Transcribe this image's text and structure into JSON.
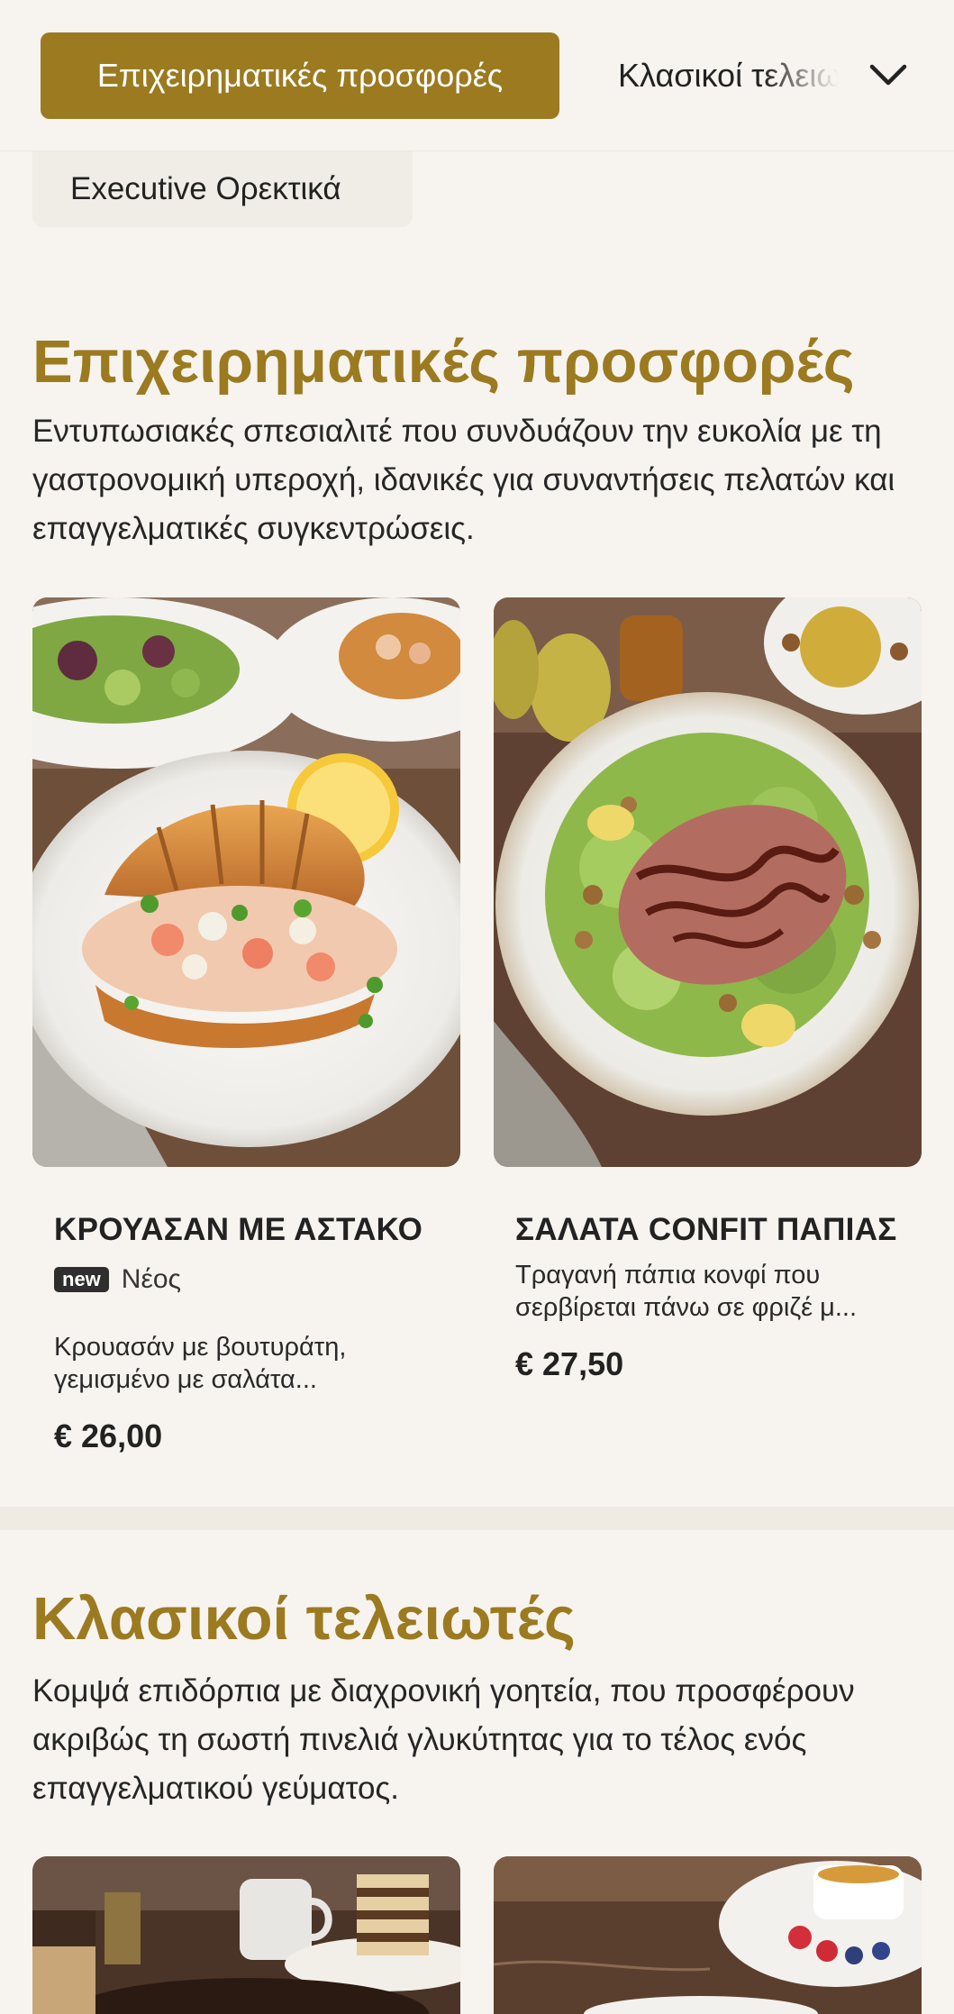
{
  "nav": {
    "active_category": "Επιχειρηματικές προσφορές",
    "next_category": "Κλασικοί τελειωτές",
    "subcategory": "Executive Ορεκτικά"
  },
  "sections": [
    {
      "title": "Επιχειρηματικές προσφορές",
      "description": "Εντυπωσιακές σπεσιαλιτέ που συνδυάζουν την ευκολία με τη γαστρονομική υπεροχή, ιδανικές για συναντήσεις πελατών και επαγγελματικές συγκεντρώσεις.",
      "items": [
        {
          "name": "ΚΡΟΥΑΣΑΝ ΜΕ ΑΣΤΑΚΟ",
          "badge": "new",
          "badge_label": "Νέος",
          "description": "Κρουασάν με βουτυράτη, γεμισμένο με σαλάτα...",
          "price": "€ 26,00"
        },
        {
          "name": "ΣΑΛΑΤΑ CONFIT ΠΑΠΙΑΣ",
          "description": "Τραγανή πάπια κονφί που σερβίρεται πάνω σε φριζέ μ...",
          "price": "€ 27,50"
        }
      ]
    },
    {
      "title": "Κλασικοί τελειωτές",
      "description": "Κομψά επιδόρπια με διαχρονική γοητεία, που προσφέρουν ακριβώς τη σωστή πινελιά γλυκύτητας για το τέλος ενός επαγγελματικού γεύματος."
    }
  ],
  "colors": {
    "accent": "#9b7a20",
    "background": "#f7f4ef",
    "chip": "#efede5"
  },
  "icons": {
    "dropdown": "chevron-down-icon"
  }
}
